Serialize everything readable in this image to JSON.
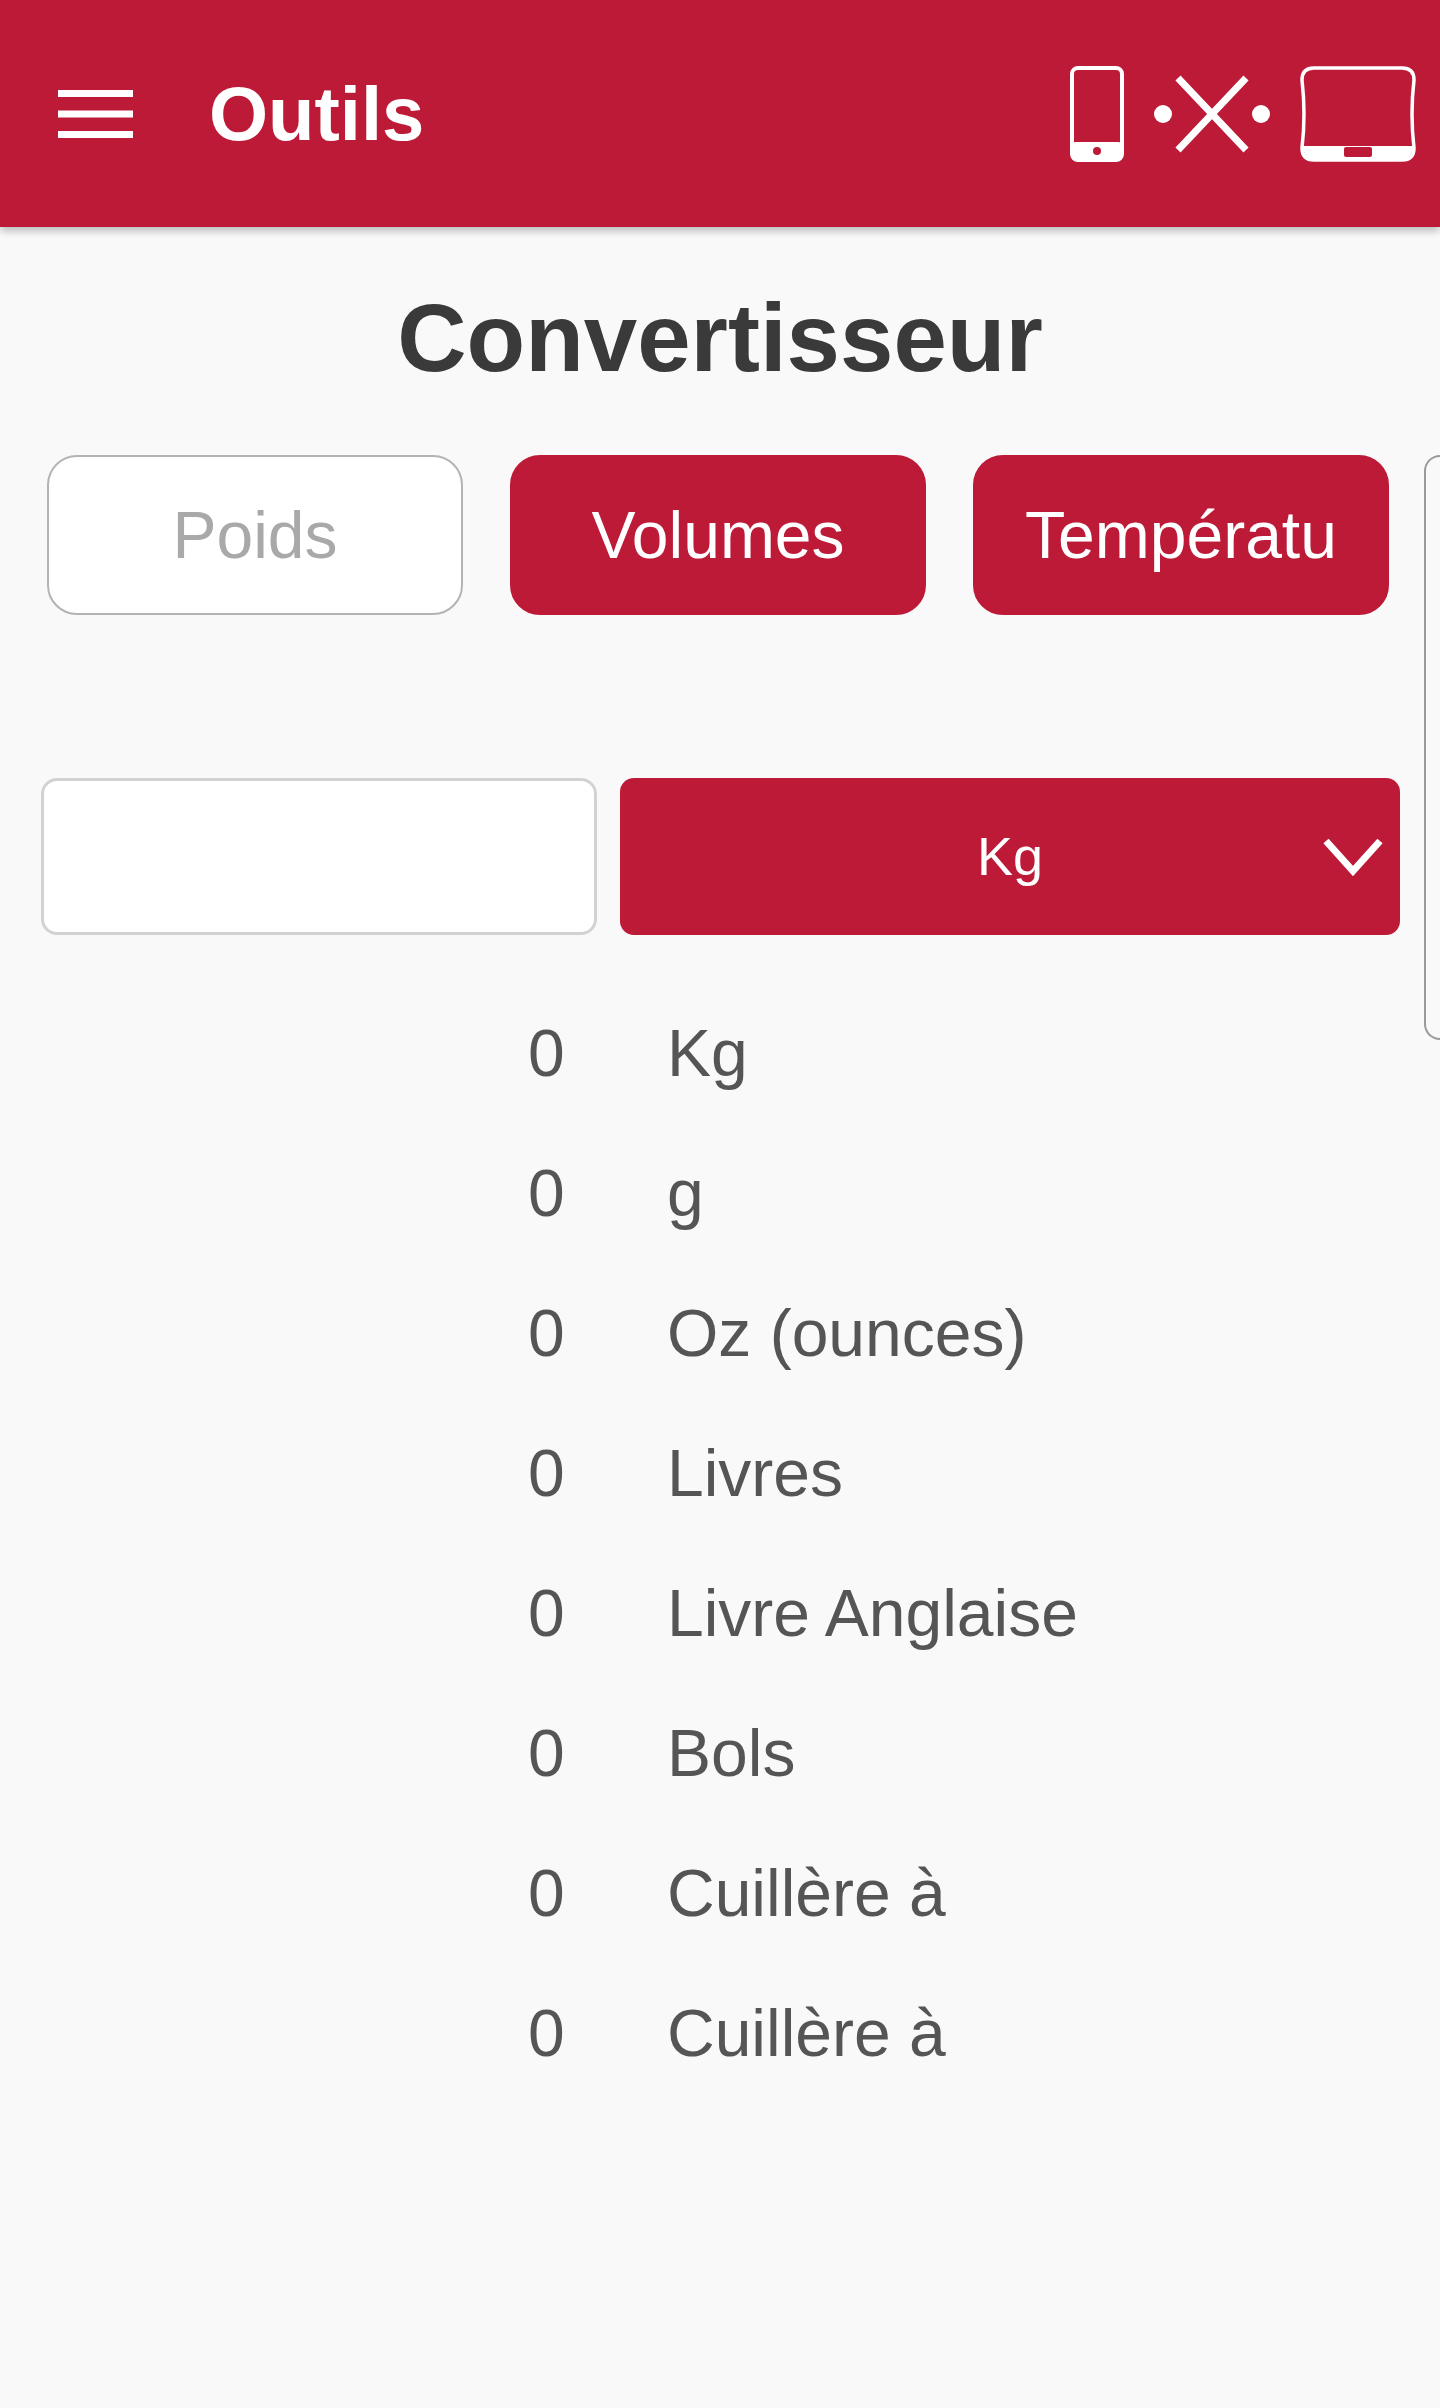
{
  "app_bar": {
    "title": "Outils"
  },
  "heading": "Convertisseur",
  "tabs": [
    {
      "label": "Poids",
      "selected": true
    },
    {
      "label": "Volumes",
      "selected": false
    },
    {
      "label": "Températu",
      "selected": false
    }
  ],
  "unit_select": {
    "value": "Kg"
  },
  "results": [
    {
      "value": "0",
      "unit": "Kg"
    },
    {
      "value": "0",
      "unit": "g"
    },
    {
      "value": "0",
      "unit": "Oz (ounces)"
    },
    {
      "value": "0",
      "unit": "Livres"
    },
    {
      "value": "0",
      "unit": "Livre Anglaise"
    },
    {
      "value": "0",
      "unit": "Bols"
    },
    {
      "value": "0",
      "unit": "Cuillère à"
    },
    {
      "value": "0",
      "unit": "Cuillère à"
    }
  ]
}
